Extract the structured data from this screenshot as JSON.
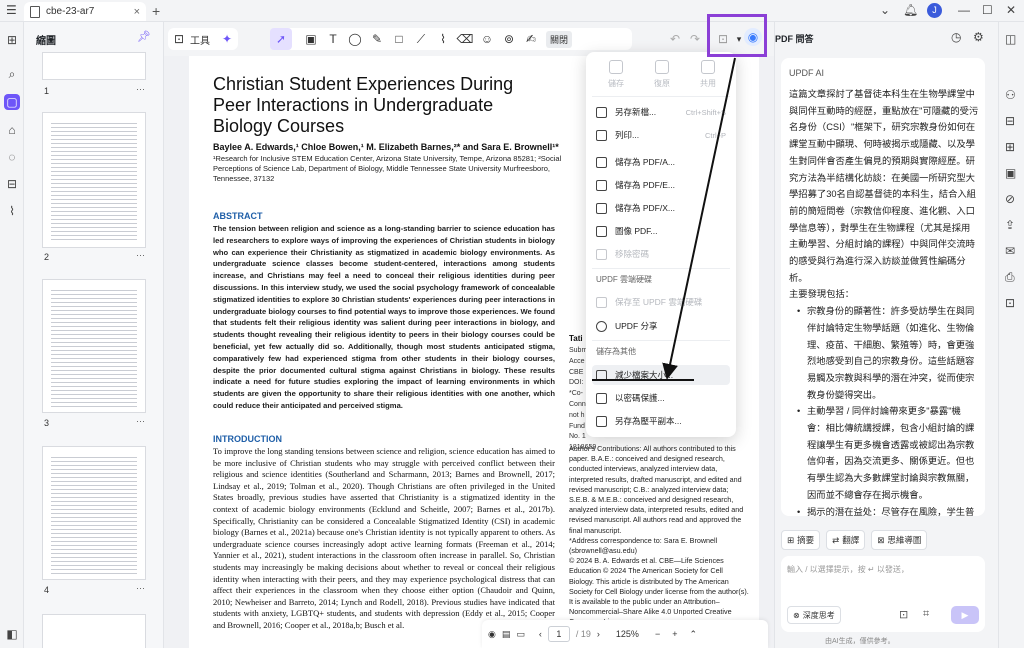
{
  "tab": {
    "title": "cbe-23-ar7",
    "close": "×",
    "new_tab": "+"
  },
  "thumbnails": {
    "title": "縮圖",
    "pages": [
      "1",
      "2",
      "3",
      "4"
    ],
    "more": "···"
  },
  "toolbar": {
    "tool_label": "工具",
    "close_chip": "關閉"
  },
  "paper": {
    "title": "Christian Student Experiences During Peer Interactions in Undergraduate Biology Courses",
    "authors": "Baylee A. Edwards,¹ Chloe Bowen,¹ M. Elizabeth Barnes,²* and Sara E. Brownell¹*",
    "affiliation": "¹Research for Inclusive STEM Education Center, Arizona State University, Tempe, Arizona 85281; ²Social Perceptions of Science Lab, Department of Biology, Middle Tennessee State University Murfreesboro, Tennessee, 37132",
    "abstract_heading": "ABSTRACT",
    "abstract": "The tension between religion and science as a long-standing barrier to science education has led researchers to explore ways of improving the experiences of Christian students in biology who can experience their Christianity as stigmatized in academic biology environments. As undergraduate science classes become student-centered, interactions among students increase, and Christians may feel a need to conceal their religious identities during peer discussions. In this interview study, we used the social psychology framework of concealable stigmatized identities to explore 30 Christian students' experiences during peer interactions in undergraduate biology courses to find potential ways to improve those experiences. We found that students felt their religious identity was salient during peer interactions in biology, and students thought revealing their religious identity to peers in their biology courses could be beneficial, yet few actually did so. Additionally, though most students anticipated stigma, comparatively few had experienced stigma from other students in their biology courses, despite the prior documented cultural stigma against Christians in biology. These results indicate a need for future studies exploring the impact of learning environments in which students are given the opportunity to share their religious identities with one another, which could reduce their anticipated and perceived stigma.",
    "intro_heading": "INTRODUCTION",
    "intro": "To improve the long standing tensions between science and religion, science education has aimed to be more inclusive of Christian students who may struggle with perceived conflict between their religious and science identities (Southerland and Scharmann, 2013; Barnes and Brownell, 2017; Lindsay et al., 2019; Tolman et al., 2020). Though Christians are often privileged in the United States broadly, previous studies have asserted that Christianity is a stigmatized identity in the context of academic biology environments (Ecklund and Scheitle, 2007; Barnes et al., 2017b). Specifically, Christianity can be considered a Concealable Stigmatized Identity (CSI) in academic biology (Barnes et al., 2021a) because one's Christian identity is not typically apparent to others. As undergraduate science courses increasingly adopt active learning formats (Freeman et al., 2014; Yannier et al., 2021), student interactions in the classroom often increase in parallel. So, Christian students may increasingly be making decisions about whether to reveal or conceal their religious identity when interacting with their peers, and they may experience psychological distress that can affect their experiences in the classroom when they choose either option (Chaudoir and Quinn, 2010; Newheiser and Barreto, 2014; Lynch and Rodell, 2018). Previous studies have indicated that students with anxiety, LGBTQ+ students, and students with depression (Eddy et al., 2015; Cooper and Brownell, 2016; Cooper et al., 2018a,b; Busch et al.",
    "side_head": "Tati",
    "side_lines": [
      "Subm",
      "Acce",
      "CBE",
      "DOI:",
      "*Co-",
      "Conn",
      "not h",
      "Fund",
      "No. 1",
      "1818659"
    ],
    "side_col": "Author's Contributions: All authors contributed to this paper. B.A.E.: conceived and designed research, conducted interviews, analyzed interview data, interpreted results, drafted manuscript, and edited and revised manuscript; C.B.: analyzed interview data; S.E.B. & M.E.B.: conceived and designed research, analyzed interview data, interpreted results, edited and revised manuscript. All authors read and approved the final manuscript.\n*Address correspondence to: Sara E. Brownell (sbrownell@asu.edu)\n© 2024 B. A. Edwards et al. CBE—Life Sciences Education © 2024 The American Society for Cell Biology. This article is distributed by The American Society for Cell Biology under license from the author(s). It is available to the public under an Attribution–Noncommercial–Share Alike 4.0 Unported Creative Commons License"
  },
  "dropdown": {
    "top": [
      "儲存",
      "復原",
      "共用"
    ],
    "items": [
      {
        "label": "另存新檔...",
        "shortcut": "Ctrl+Shift+S",
        "disabled": false
      },
      {
        "label": "列印...",
        "shortcut": "Ctrl+P",
        "disabled": false
      },
      {
        "label": "儲存為 PDF/A...",
        "shortcut": "",
        "disabled": false
      },
      {
        "label": "儲存為 PDF/E...",
        "shortcut": "",
        "disabled": false
      },
      {
        "label": "儲存為 PDF/X...",
        "shortcut": "",
        "disabled": false
      },
      {
        "label": "圖像 PDF...",
        "shortcut": "",
        "disabled": false
      },
      {
        "label": "移除密碼",
        "shortcut": "",
        "disabled": true
      }
    ],
    "cloud_section": "UPDF 雲端硬碟",
    "cloud_items": [
      {
        "label": "保存至 UPDF 雲端硬碟",
        "disabled": true
      },
      {
        "label": "UPDF 分享",
        "disabled": false
      }
    ],
    "save_other_section": "儲存為其他",
    "other_items": [
      {
        "label": "減少檔案大小...",
        "highlight": true
      },
      {
        "label": "以密碼保護...",
        "highlight": false
      },
      {
        "label": "另存為壓平副本...",
        "highlight": false
      }
    ]
  },
  "bottom_nav": {
    "page": "1",
    "total": "/ 19",
    "zoom": "125%",
    "minus": "−",
    "plus": "+"
  },
  "ai": {
    "panel_title": "PDF 問答",
    "label": "UPDF AI",
    "intro": "這篇文章探討了基督徒本科生在生物學課堂中與同伴互動時的經歷，重點放在\"可隱藏的受污名身份（CSI）\"框架下，研究宗教身份如何在課堂互動中顯現、何時被揭示或隱藏、以及學生對同伴會否產生偏見的預期與實際經歷。研究方法為半結構化訪談：在美國一所研究型大學招募了30名自認基督徒的本科生，結合入組前的簡短問卷（宗教信仰程度、進化觀、入口學信息等），對學生在生物課程（尤其是採用主動學習、分組討論的課程）中與同伴交流時的感受與行為進行深入訪談並做質性編碼分析。",
    "findings_label": "主要發現包括：",
    "bullets": [
      "宗教身份的顯著性：許多受訪學生在與同伴討論特定生物學話題（如進化、生物倫理、疫苗、干細胞、繁殖等）時，會更強烈地感受到自己的宗教身份。這些話題容易觸及宗教與科學的潛在沖突，從而使宗教身份變得突出。",
      "主動學習 / 同伴討論帶來更多\"暴露\"機會：相比傳統講授課，包含小組討論的課程讓學生有更多機會透露或被認出為宗教信仰者，因為交流更多、關係更近。但也有學生認為大多數課堂討論與宗教無關，因而並不總會存在揭示機會。",
      "揭示的潛在益处：尽管存在風險，学生普遍认为在同伴面前透露宗教身份有其"
    ],
    "actions": [
      "摘要",
      "翻譯",
      "思維導圖"
    ],
    "input_placeholder": "輸入 / 以選擇提示，按 ↵ 以發送，",
    "deep_think": "深度思考",
    "footer": "由AI生成，僅供參考。"
  }
}
